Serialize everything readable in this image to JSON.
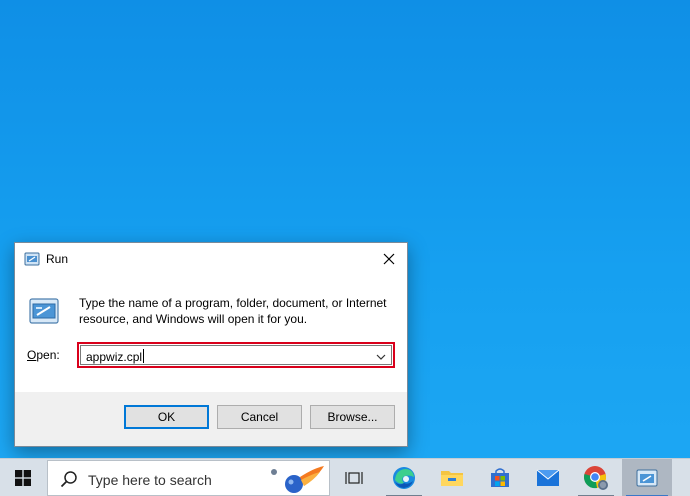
{
  "dialog": {
    "title": "Run",
    "description": "Type the name of a program, folder, document, or Internet resource, and Windows will open it for you.",
    "open_label_prefix": "O",
    "open_label_rest": "pen:",
    "open_value": "appwiz.cpl",
    "ok_label": "OK",
    "cancel_label": "Cancel",
    "browse_label": "Browse..."
  },
  "taskbar": {
    "search_placeholder": "Type here to search",
    "icons": [
      "windows-start-icon",
      "search-icon",
      "task-view-icon",
      "edge-icon",
      "file-explorer-icon",
      "store-icon",
      "mail-icon",
      "chrome-icon",
      "run-icon"
    ]
  },
  "colors": {
    "desktop": "#16a0f0",
    "input_highlight": "#d9001b",
    "accent": "#0078d7"
  }
}
